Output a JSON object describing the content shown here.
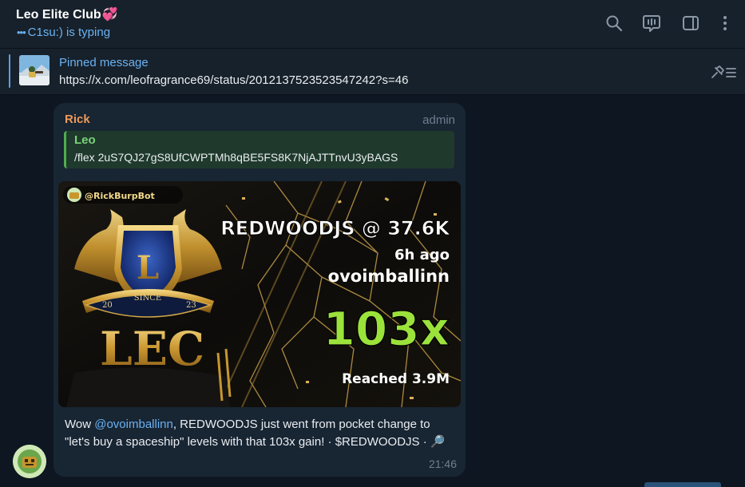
{
  "header": {
    "title": "Leo Elite Club",
    "title_emoji": "💞",
    "typing_dots": "•••",
    "status": "C1su:) is typing"
  },
  "pinned": {
    "title": "Pinned message",
    "text": "https://x.com/leofragrance69/status/2012137523523547242?s=46"
  },
  "message": {
    "sender": "Rick",
    "role": "admin",
    "reply": {
      "author": "Leo",
      "text": "/flex 2uS7QJ27gS8UfCWPTMh8qBE5FS8K7NjAJTTnvU3yBAGS"
    },
    "image": {
      "bot_tag": "@RickBurpBot",
      "token_line": "REDWOODJS @ 37.6K",
      "time_ago": "6h ago",
      "user": "ovoimballinn",
      "multiplier": "103x",
      "reached": "Reached 3.9M",
      "crest_letter": "L",
      "since": "SINCE",
      "year_left": "20",
      "year_right": "23",
      "brand": "LEC"
    },
    "caption": {
      "prefix": "Wow ",
      "mention": "@ovoimballinn",
      "body": ", REDWOODJS just went from pocket change to \"let's buy a spaceship\" levels with that 103x gain! · $REDWOODJS · 🔎"
    },
    "time": "21:46"
  },
  "colors": {
    "background": "#0e1621",
    "panel": "#17212b",
    "bubble": "#182533",
    "accent": "#6ab2f2",
    "sender": "#ee9a58",
    "reply_author": "#7cd37a",
    "multiplier": "#9be23b"
  },
  "icons": [
    "search-icon",
    "live-stream-icon",
    "sidebar-toggle-icon",
    "more-vertical-icon",
    "unpin-list-icon"
  ]
}
